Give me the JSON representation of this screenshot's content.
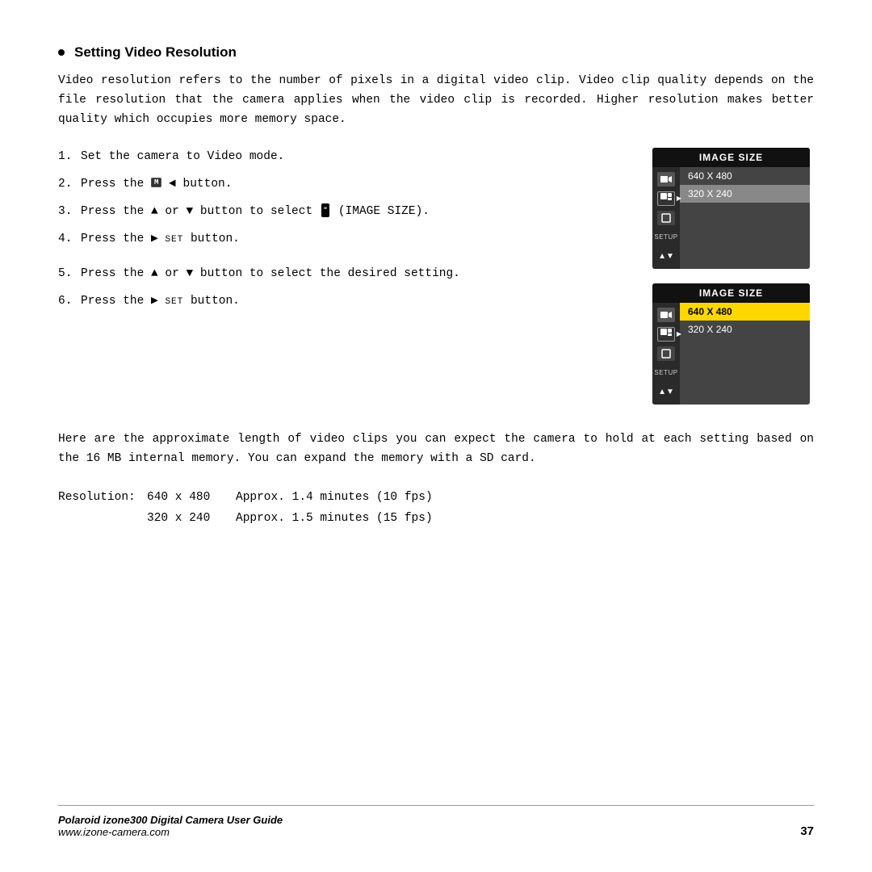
{
  "page": {
    "title": "Setting Video Resolution",
    "intro": "Video  resolution  refers  to  the  number  of  pixels  in  a  digital  video  clip. Video  clip  quality  depends  on  the  file  resolution  that  the  camera  applies when  the  video  clip  is  recorded.  Higher  resolution  makes  better  quality which  occupies  more  memory  space.",
    "steps_group1": [
      {
        "num": "1.",
        "text": "Set the camera to Video mode."
      },
      {
        "num": "2.",
        "text": "Press the [M] ◄ button."
      },
      {
        "num": "3.",
        "text": "Press the ▲ or ▼ button to select [IMG] (IMAGE SIZE)."
      },
      {
        "num": "4.",
        "text": "Press the ► SET button."
      }
    ],
    "steps_group2": [
      {
        "num": "5.",
        "text": "Press the ▲ or ▼ button to select the desired setting."
      },
      {
        "num": "6.",
        "text": "Press the ► SET button."
      }
    ],
    "ui_panel1": {
      "header": "IMAGE SIZE",
      "options": [
        "640 X 480",
        "320 X 240"
      ],
      "selected_index": 1,
      "icons": [
        "video",
        "imagesize",
        "square",
        "setup",
        "arrow-down"
      ]
    },
    "ui_panel2": {
      "header": "IMAGE SIZE",
      "options": [
        "640 X 480",
        "320 X 240"
      ],
      "highlighted_index": 0,
      "icons": [
        "video",
        "imagesize",
        "square",
        "setup",
        "arrow-down"
      ]
    },
    "bottom_paragraph": "Here  are  the  approximate  length  of  video  clips  you  can  expect  the camera  to  hold  at  each  setting  based  on  the  16  MB  internal  memory. You  can  expand  the  memory  with  a  SD  card.",
    "resolution_label": "Resolution:",
    "resolutions": [
      {
        "size": "640 x 480",
        "approx": "Approx. 1.4 minutes (10 fps)"
      },
      {
        "size": "320 x 240",
        "approx": "Approx. 1.5 minutes (15 fps)"
      }
    ],
    "footer": {
      "brand": "Polaroid izone300 Digital Camera User Guide",
      "url": "www.izone-camera.com",
      "page_number": "37"
    }
  }
}
